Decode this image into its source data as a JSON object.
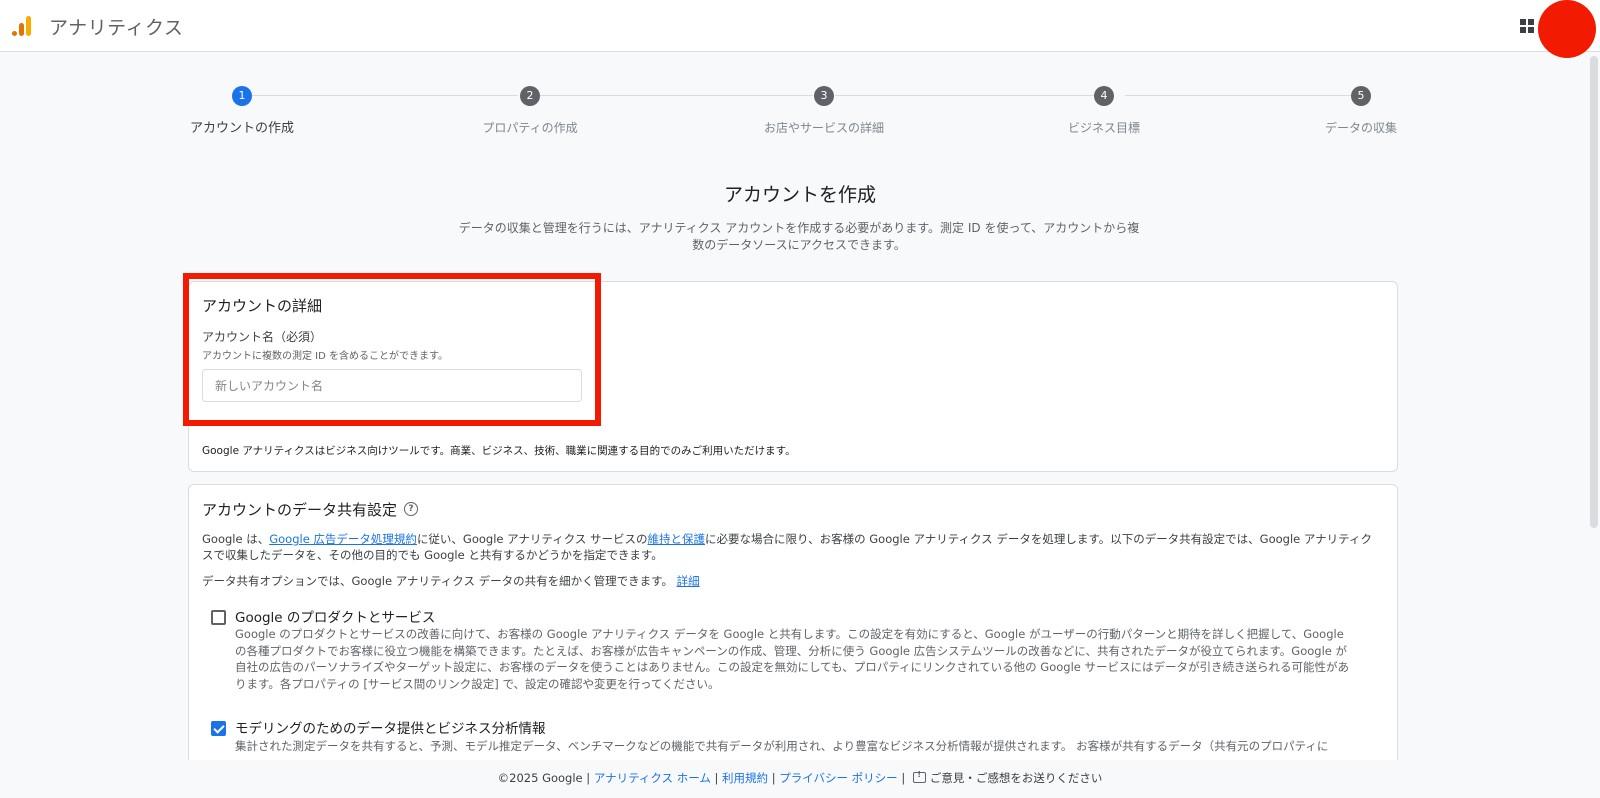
{
  "header": {
    "app_title": "アナリティクス",
    "brand_colors": {
      "logo_orange": "#f9ab00",
      "logo_dark": "#e37400",
      "avatar": "#f21a00"
    }
  },
  "stepper": {
    "steps": [
      {
        "number": "1",
        "label": "アカウントの作成",
        "active": true
      },
      {
        "number": "2",
        "label": "プロパティの作成",
        "active": false
      },
      {
        "number": "3",
        "label": "お店やサービスの詳細",
        "active": false
      },
      {
        "number": "4",
        "label": "ビジネス目標",
        "active": false
      },
      {
        "number": "5",
        "label": "データの収集",
        "active": false
      }
    ],
    "active_color": "#1a73e8"
  },
  "main": {
    "title": "アカウントを作成",
    "description": "データの収集と管理を行うには、アナリティクス アカウントを作成する必要があります。測定 ID を使って、アカウントから複数のデータソースにアクセスできます。"
  },
  "account_details": {
    "title": "アカウントの詳細",
    "name_label": "アカウント名（必須）",
    "name_help": "アカウントに複数の測定 ID を含めることができます。",
    "name_value": "",
    "name_placeholder": "新しいアカウント名",
    "note": "Google アナリティクスはビジネス向けツールです。商業、ビジネス、技術、職業に関連する目的でのみご利用いただけます。"
  },
  "data_sharing": {
    "title": "アカウントのデータ共有設定",
    "intro_1_pre": "Google は、",
    "intro_1_link1": "Google 広告データ処理規約",
    "intro_1_mid": "に従い、Google アナリティクス サービスの",
    "intro_1_link2": "維持と保護",
    "intro_1_post": "に必要な場合に限り、お客様の Google アナリティクス データを処理します。以下のデータ共有設定では、Google アナリティクスで収集したデータを、その他の目的でも Google と共有するかどうかを指定できます。",
    "intro_2": "データ共有オプションでは、Google アナリティクス データの共有を細かく管理できます。",
    "intro_2_link": "詳細",
    "options": [
      {
        "title": "Google のプロダクトとサービス",
        "checked": false,
        "description": "Google のプロダクトとサービスの改善に向けて、お客様の Google アナリティクス データを Google と共有します。この設定を有効にすると、Google がユーザーの行動パターンと期待を詳しく把握して、Google の各種プロダクトでお客様に役立つ機能を構築できます。たとえば、お客様が広告キャンペーンの作成、管理、分析に使う Google 広告システムツールの改善などに、共有されたデータが役立てられます。Google が自社の広告のパーソナライズやターゲット設定に、お客様のデータを使うことはありません。この設定を無効にしても、プロパティにリンクされている他の Google サービスにはデータが引き続き送られる可能性があります。各プロパティの [サービス間のリンク設定] で、設定の確認や変更を行ってください。"
      },
      {
        "title": "モデリングのためのデータ提供とビジネス分析情報",
        "checked": true,
        "description": "集計された測定データを共有すると、予測、モデル推定データ、ベンチマークなどの機能で共有データが利用され、より豊富なビジネス分析情報が提供されます。 お客様が共有するデータ（共有元のプロパティに"
      }
    ]
  },
  "footer": {
    "copyright": "©2025 Google",
    "sep": "|",
    "link_home": "アナリティクス ホーム",
    "link_terms": "利用規約",
    "link_privacy": "プライバシー ポリシー",
    "feedback": "ご意見・ご感想をお送りください"
  }
}
